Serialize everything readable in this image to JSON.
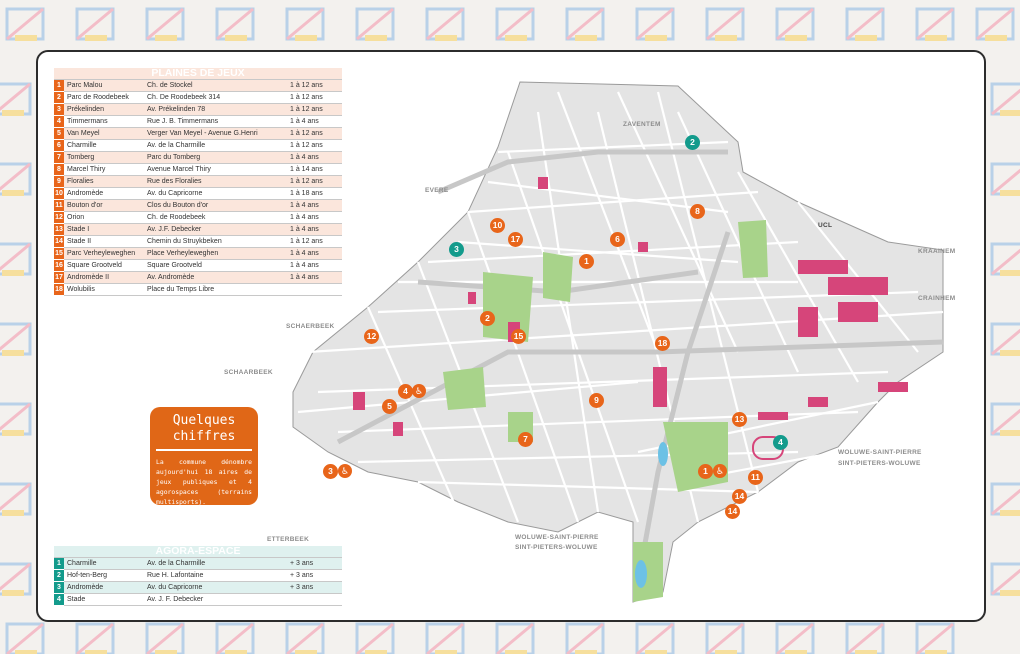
{
  "plaines": {
    "title": "PLAINES DE JEUX",
    "rows": [
      {
        "n": "1",
        "name": "Parc Malou",
        "addr": "Ch. de Stockel",
        "age": "1 à 12 ans"
      },
      {
        "n": "2",
        "name": "Parc de Roodebeek",
        "addr": "Ch. De Roodebeek 314",
        "age": "1 à 12 ans"
      },
      {
        "n": "3",
        "name": "Prékelinden",
        "addr": "Av. Prékelinden 78",
        "age": "1 à 12 ans"
      },
      {
        "n": "4",
        "name": "Timmermans",
        "addr": "Rue J. B. Timmermans",
        "age": "1 à 4 ans"
      },
      {
        "n": "5",
        "name": "Van Meyel",
        "addr": "Verger Van Meyel - Avenue G.Henri",
        "age": "1 à 12 ans"
      },
      {
        "n": "6",
        "name": "Charmille",
        "addr": "Av. de la Charmille",
        "age": "1 à 12 ans"
      },
      {
        "n": "7",
        "name": "Tomberg",
        "addr": "Parc du Tomberg",
        "age": "1 à 4 ans"
      },
      {
        "n": "8",
        "name": "Marcel Thiry",
        "addr": "Avenue Marcel Thiry",
        "age": "1 à 14 ans"
      },
      {
        "n": "9",
        "name": "Floralies",
        "addr": "Rue des Floralies",
        "age": "1 à 12 ans"
      },
      {
        "n": "10",
        "name": "Andromède",
        "addr": "Av. du Capricorne",
        "age": "1 à 18 ans"
      },
      {
        "n": "11",
        "name": "Bouton d'or",
        "addr": "Clos du Bouton d'or",
        "age": "1 à 4 ans"
      },
      {
        "n": "12",
        "name": "Orion",
        "addr": "Ch. de Roodebeek",
        "age": "1 à 4 ans"
      },
      {
        "n": "13",
        "name": "Stade I",
        "addr": "Av. J.F. Debecker",
        "age": "1 à 4 ans"
      },
      {
        "n": "14",
        "name": "Stade II",
        "addr": "Chemin du Struykbeken",
        "age": "1 à 12 ans"
      },
      {
        "n": "15",
        "name": "Parc Verheyleweghen",
        "addr": "Place Verheyleweghen",
        "age": "1 à 4 ans"
      },
      {
        "n": "16",
        "name": "Square Grootveld",
        "addr": "Square Grootveld",
        "age": "1 à 4 ans"
      },
      {
        "n": "17",
        "name": "Andromède II",
        "addr": "Av. Andromède",
        "age": "1 à 4 ans"
      },
      {
        "n": "18",
        "name": "Wolubilis",
        "addr": "Place du Temps Libre",
        "age": ""
      }
    ]
  },
  "agora": {
    "title": "AGORA-ESPACE",
    "rows": [
      {
        "n": "1",
        "name": "Charmille",
        "addr": "Av. de la Charmille",
        "age": "+ 3 ans"
      },
      {
        "n": "2",
        "name": "Hof-ten-Berg",
        "addr": "Rue H. Lafontaine",
        "age": "+ 3 ans"
      },
      {
        "n": "3",
        "name": "Andromède",
        "addr": "Av. du Capricorne",
        "age": "+ 3 ans"
      },
      {
        "n": "4",
        "name": "Stade",
        "addr": "Av. J. F. Debecker",
        "age": ""
      }
    ]
  },
  "info": {
    "title_line1": "Quelques",
    "title_line2": "chiffres",
    "text": "La commune dénombre aujourd'hui 18 aires de jeux publiques et 4 agorospaces (terrains multisports)."
  },
  "places": {
    "zaventem": "ZAVENTEM",
    "evere": "EVERE",
    "kraainem": "KRAAINEM",
    "crainhem": "CRAINHEM",
    "schaerbeek": "SCHAERBEEK",
    "schaarbeek": "SCHAARBEEK",
    "woluwe_sp_fr": "WOLUWE-SAINT-PIERRE",
    "woluwe_sp_nl": "SINT-PIETERS-WOLUWE",
    "etterbeek": "ETTERBEEK",
    "woluwe_sp_fr_2": "WOLUWE-SAINT-PIERRE",
    "woluwe_sp_nl_2": "SINT-PIETERS-WOLUWE",
    "ucl": "UCL"
  },
  "markers": {
    "orange": [
      "2",
      "8",
      "10",
      "17",
      "6",
      "1",
      "2",
      "12",
      "15",
      "18",
      "4",
      "9",
      "5",
      "13",
      "7",
      "3",
      "1",
      "11",
      "14",
      "14"
    ],
    "teal": [
      "2",
      "3",
      "4"
    ]
  },
  "colors": {
    "orange": "#e8651a",
    "teal": "#139b8c",
    "park": "#a8d38a",
    "building": "#d6457a"
  }
}
